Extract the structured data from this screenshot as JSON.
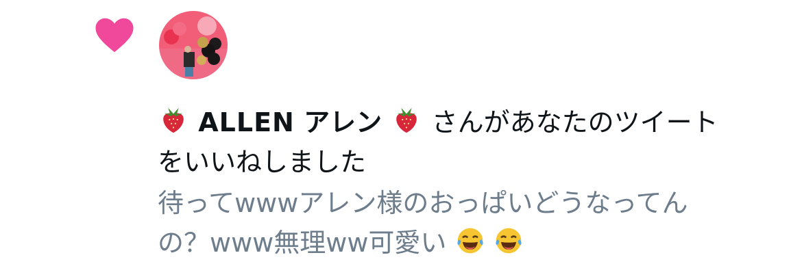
{
  "notification": {
    "icon": "heart-icon",
    "icon_color": "#f0489a",
    "avatar": "user-avatar-photo",
    "user_display_name": "ALLEN アレン",
    "user_display_name_latin": "ALLEN",
    "user_display_name_kana": "アレン",
    "name_emoji": "strawberry-icon",
    "action_text": "さんがあなたのツイートをいいねしました",
    "action_text_line1": "さんがあなたのツイート",
    "action_text_line2": "をいいねしました"
  },
  "tweet": {
    "text": "待ってwwwアレン様のおっぱいどうなってんの？www無理ww可愛い😂😂",
    "text_line1": "待ってwwwアレン様のおっぱいどうなってん",
    "text_line2": "の？www無理ww可愛い",
    "trailing_emoji": "face-with-tears-of-joy-icon",
    "text_color": "#6e7d8c"
  }
}
